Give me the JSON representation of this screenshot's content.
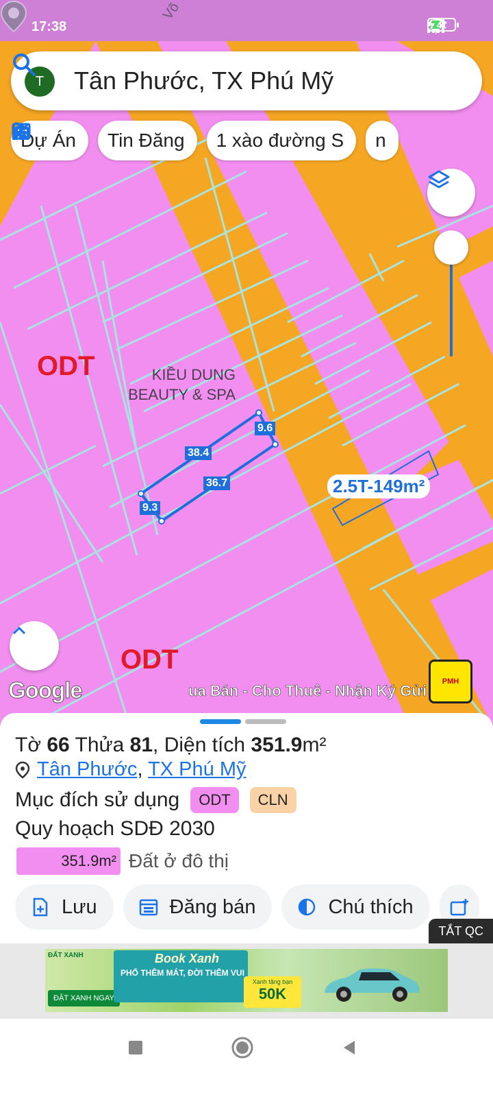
{
  "status_bar": {
    "time": "17:38",
    "battery": "41"
  },
  "search": {
    "avatar_letter": "T",
    "query": "Tân Phước, TX Phú Mỹ"
  },
  "chips": [
    {
      "label": "Dự Án",
      "icon": "building-icon"
    },
    {
      "label": "Tin Đăng",
      "icon": "calendar-icon"
    },
    {
      "label": "1 xào đường S",
      "icon": "percent-icon"
    },
    {
      "label": "n",
      "icon": "percent-icon"
    }
  ],
  "map": {
    "street_name": "Võ Văn Tần",
    "zone_label_1": "ODT",
    "zone_label_2": "ODT",
    "poi_line1": "KIỀU DUNG",
    "poi_line2": "BEAUTY & SPA",
    "dimensions": [
      "9.6",
      "38.4",
      "36.7",
      "9.3"
    ],
    "price_label": "2.5T-149m²",
    "google": "Google",
    "watermark": "ua Bán - Cho Thuê - Nhận Ký Gửi",
    "pmh_logo": "PMH"
  },
  "sheet": {
    "to_label": "Tờ",
    "to_value": "66",
    "thua_label": "Thửa",
    "thua_value": "81",
    "dien_tich_label": "Diện tích",
    "dien_tich_value": "351.9",
    "dien_tich_unit": "m²",
    "location_part1": "Tân Phước",
    "location_sep": ",",
    "location_part2": "TX Phú Mỹ",
    "muc_dich_label": "Mục đích sử dụng",
    "badge_odt": "ODT",
    "badge_cln": "CLN",
    "quy_hoach": "Quy hoạch SDĐ 2030",
    "area_value": "351.9m²",
    "area_desc": "Đất ở đô thị",
    "actions": [
      "Lưu",
      "Đăng bán",
      "Chú thích"
    ],
    "tat_qc": "TẮT QC"
  },
  "ad": {
    "logo": "ĐẤT XANH",
    "cta": "ĐẶT XANH NGAY",
    "title": "Book Xanh",
    "subtitle": "PHỐ THÊM MÁT, ĐỜI THÊM VUI",
    "promo_top": "Xanh tặng bạn",
    "promo_value": "50K"
  },
  "colors": {
    "odt_pink": "#f28ef0",
    "road_orange": "#f5a623",
    "accent_blue": "#1e6fd9",
    "cln_badge": "#fbd2a5"
  }
}
